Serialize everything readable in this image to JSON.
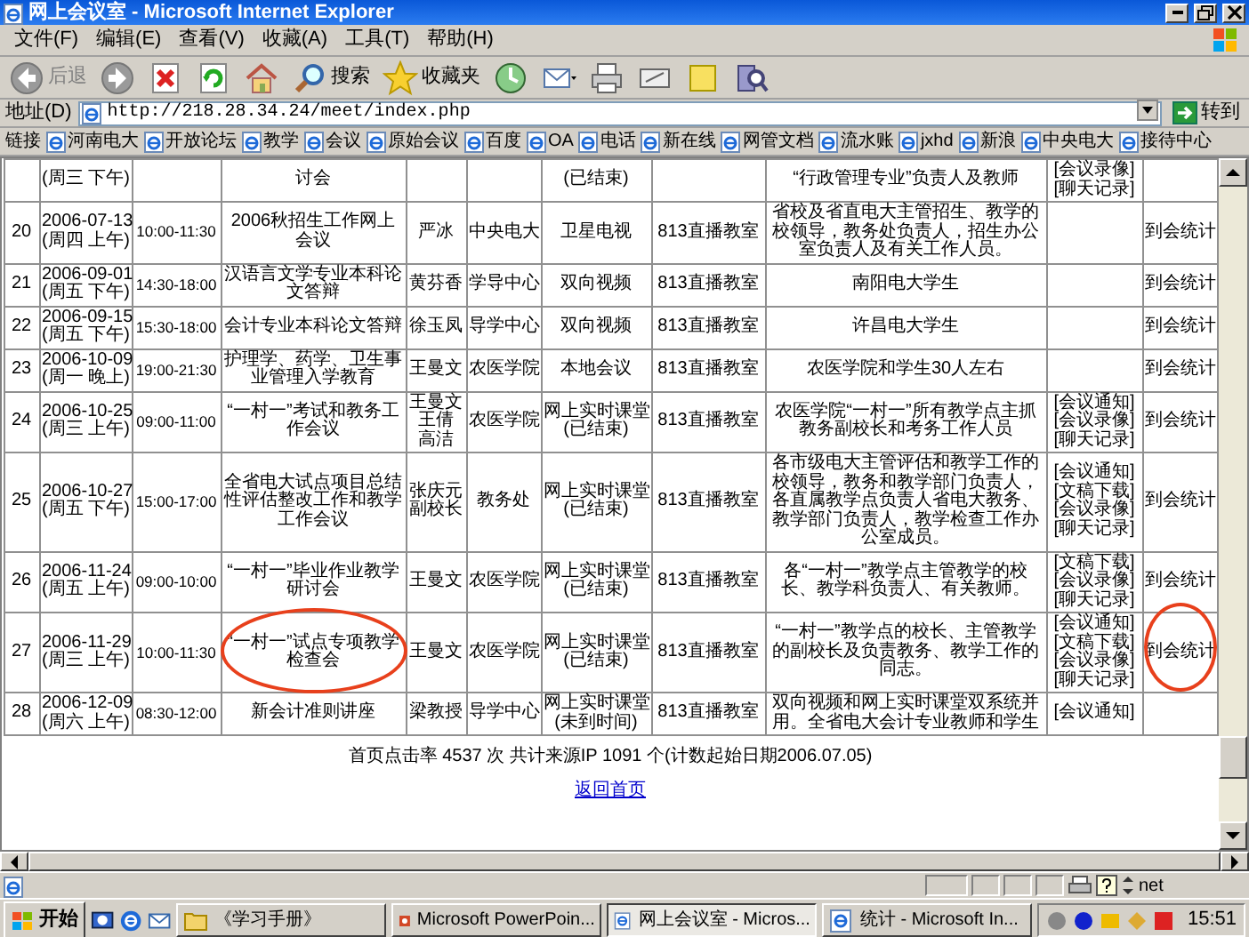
{
  "window": {
    "title": "网上会议室 - Microsoft Internet Explorer"
  },
  "menu": [
    "文件(F)",
    "编辑(E)",
    "查看(V)",
    "收藏(A)",
    "工具(T)",
    "帮助(H)"
  ],
  "toolbar": {
    "back": "后退",
    "search": "搜索",
    "favorites": "收藏夹"
  },
  "address": {
    "label": "地址(D)",
    "url": "http://218.28.34.24/meet/index.php",
    "go": "转到"
  },
  "links": {
    "label": "链接",
    "items": [
      "河南电大",
      "开放论坛",
      "教学",
      "会议",
      "原始会议",
      "百度",
      "OA",
      "电话",
      "新在线",
      "网管文档",
      "流水账",
      "jxhd",
      "新浪",
      "中央电大",
      "接待中心"
    ]
  },
  "table": {
    "rows": [
      {
        "day": "(周三 下午)",
        "topic": "讨会",
        "mode_note": "(已结束)",
        "participants": "“行政管理专业”负责人及教师",
        "links": [
          "[会议录像]",
          "[聊天记录]"
        ]
      },
      {
        "no": "20",
        "date": "2006-07-13",
        "day": "(周四 上午)",
        "time": "10:00-11:30",
        "topic": "2006秋招生工作网上会议",
        "host": [
          "严冰"
        ],
        "dept": "中央电大",
        "mode": "卫星电视",
        "venue": "813直播教室",
        "participants": "省校及省直电大主管招生、教学的校领导，教务处负责人，招生办公室负责人及有关工作人员。",
        "stats": "到会统计"
      },
      {
        "no": "21",
        "date": "2006-09-01",
        "day": "(周五 下午)",
        "time": "14:30-18:00",
        "topic": "汉语言文学专业本科论文答辩",
        "host": [
          "黄芬香"
        ],
        "dept": "学导中心",
        "mode": "双向视频",
        "venue": "813直播教室",
        "participants": "南阳电大学生",
        "stats": "到会统计"
      },
      {
        "no": "22",
        "date": "2006-09-15",
        "day": "(周五 下午)",
        "time": "15:30-18:00",
        "topic": "会计专业本科论文答辩",
        "host": [
          "徐玉凤"
        ],
        "dept": "导学中心",
        "mode": "双向视频",
        "venue": "813直播教室",
        "participants": "许昌电大学生",
        "stats": "到会统计"
      },
      {
        "no": "23",
        "date": "2006-10-09",
        "day": "(周一 晚上)",
        "time": "19:00-21:30",
        "topic": "护理学、药学、卫生事业管理入学教育",
        "host": [
          "王曼文"
        ],
        "dept": "农医学院",
        "mode": "本地会议",
        "venue": "813直播教室",
        "participants": "农医学院和学生30人左右",
        "stats": "到会统计"
      },
      {
        "no": "24",
        "date": "2006-10-25",
        "day": "(周三 上午)",
        "time": "09:00-11:00",
        "topic": "“一村一”考试和教务工作会议",
        "host": [
          "王曼文",
          "王倩",
          "高洁"
        ],
        "dept": "农医学院",
        "mode": "网上实时课堂",
        "mode_note": "(已结束)",
        "venue": "813直播教室",
        "participants": "农医学院“一村一”所有教学点主抓教务副校长和考务工作人员",
        "links": [
          "[会议通知]",
          "[会议录像]",
          "[聊天记录]"
        ],
        "stats": "到会统计"
      },
      {
        "no": "25",
        "date": "2006-10-27",
        "day": "(周五 下午)",
        "time": "15:00-17:00",
        "topic": "全省电大试点项目总结性评估整改工作和教学工作会议",
        "host": [
          "张庆元",
          "副校长"
        ],
        "dept": "教务处",
        "mode": "网上实时课堂",
        "mode_note": "(已结束)",
        "venue": "813直播教室",
        "participants": "各市级电大主管评估和教学工作的校领导，教务和教学部门负责人，各直属教学点负责人省电大教务、教学部门负责人，教学检查工作办公室成员。",
        "links": [
          "[会议通知]",
          "[文稿下载]",
          "[会议录像]",
          "[聊天记录]"
        ],
        "stats": "到会统计"
      },
      {
        "no": "26",
        "date": "2006-11-24",
        "day": "(周五 上午)",
        "time": "09:00-10:00",
        "topic": "“一村一”毕业作业教学研讨会",
        "host": [
          "王曼文"
        ],
        "dept": "农医学院",
        "mode": "网上实时课堂",
        "mode_note": "(已结束)",
        "venue": "813直播教室",
        "participants": "各“一村一”教学点主管教学的校长、教学科负责人、有关教师。",
        "links": [
          "[文稿下载]",
          "[会议录像]",
          "[聊天记录]"
        ],
        "stats": "到会统计"
      },
      {
        "no": "27",
        "date": "2006-11-29",
        "day": "(周三 上午)",
        "time": "10:00-11:30",
        "topic": "“一村一”试点专项教学检查会",
        "host": [
          "王曼文"
        ],
        "dept": "农医学院",
        "mode": "网上实时课堂",
        "mode_note": "(已结束)",
        "venue": "813直播教室",
        "participants": "“一村一”教学点的校长、主管教学的副校长及负责教务、教学工作的同志。",
        "links": [
          "[会议通知]",
          "[文稿下载]",
          "[会议录像]",
          "[聊天记录]"
        ],
        "stats": "到会统计",
        "circled": true
      },
      {
        "no": "28",
        "date": "2006-12-09",
        "day": "(周六 上午)",
        "time": "08:30-12:00",
        "topic": "新会计准则讲座",
        "host": [
          "梁教授"
        ],
        "dept": "导学中心",
        "mode": "网上实时课堂",
        "mode_note": "(未到时间)",
        "venue": "813直播教室",
        "participants": "双向视频和网上实时课堂双系统并用。全省电大会计专业教师和学生",
        "links": [
          "[会议通知]"
        ]
      }
    ]
  },
  "footer": {
    "stats": "首页点击率 4537 次 共计来源IP 1091 个(计数起始日期2006.07.05)",
    "back_link": "返回首页"
  },
  "status_bar": {
    "zone": "net"
  },
  "taskbar": {
    "start": "开始",
    "tasks": [
      {
        "label": "《学习手册》",
        "kind": "folder",
        "selected": false
      },
      {
        "label": "Microsoft PowerPoin...",
        "kind": "ppt",
        "selected": false
      },
      {
        "label": "网上会议室 - Micros...",
        "kind": "ie",
        "selected": true
      },
      {
        "label": "统计 - Microsoft In...",
        "kind": "ie",
        "selected": false
      }
    ],
    "clock": "15:51"
  }
}
